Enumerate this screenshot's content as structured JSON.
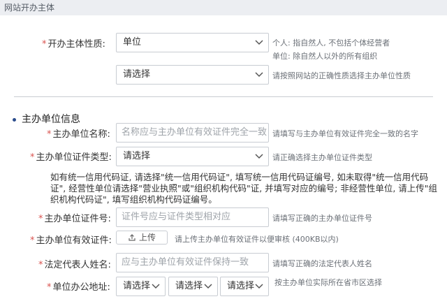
{
  "header": {
    "title": "网站开办主体"
  },
  "entity_nature": {
    "required_mark": "*",
    "label": "开办主体性质:",
    "value": "单位",
    "hint_line1": "个人: 指自然人, 不包括个体经营者",
    "hint_line2": "单位: 除自然人以外的所有组织"
  },
  "unit_nature": {
    "value": "请选择",
    "hint": "请按照网站的正确性质选择主办单位性质"
  },
  "section": {
    "title": "主办单位信息"
  },
  "unit_name": {
    "required_mark": "*",
    "label": "主办单位名称:",
    "placeholder": "名称应与主办单位有效证件完全一致",
    "hint": "请填写与主办单位有效证件完全一致的名字"
  },
  "cert_type": {
    "required_mark": "*",
    "label": "主办单位证件类型:",
    "value": "请选择",
    "hint": "请正确选择主办单位证件类型"
  },
  "cert_note": "如有统一信用代码证, 请选择\"统一信用代码证\", 填写统一信用代码证编号, 如未取得\"统一信用代码证\", 经营性单位请选择\"营业执照\"或\"组织机构代码\"证, 并填写对应的编号; 非经营性单位, 请上传\"组织机构代码证\", 填写组织机构代码证编号。",
  "cert_number": {
    "required_mark": "*",
    "label": "主办单位证件号:",
    "placeholder": "证件号应与证件类型相对应",
    "hint": "请填写正确的主办单位证件号"
  },
  "cert_upload": {
    "required_mark": "*",
    "label": "主办单位有效证件:",
    "button_label": "上传",
    "hint": "请上传主办单位有效证件以便审核 (400KB以内)"
  },
  "legal_rep": {
    "required_mark": "*",
    "label": "法定代表人姓名:",
    "placeholder": "应与主办单位有效证件保持一致",
    "hint": "请填写正确的法定代表人姓名"
  },
  "office_address": {
    "required_mark": "*",
    "label": "单位办公地址:",
    "province": "请选择",
    "city": "请选择",
    "district": "请选择",
    "hint": "按主办单位实际所在省市区选择"
  },
  "colors": {
    "required": "#d9534f",
    "header_bg": "#eceef2",
    "border": "#c8ccd2"
  }
}
